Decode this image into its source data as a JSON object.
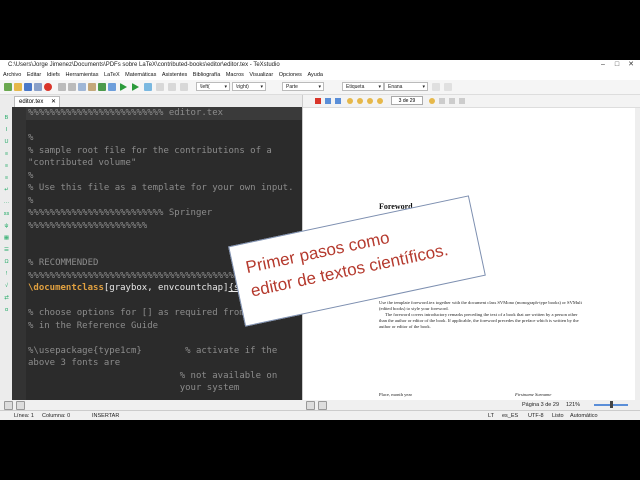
{
  "window": {
    "title": "C:\\Users\\Jorge Jimenez\\Documents\\PDFs sobre LaTeX\\contributed-books\\editor\\editor.tex - TeXstudio",
    "controls": [
      "–",
      "□",
      "✕"
    ]
  },
  "menu": [
    "Archivo",
    "Editar",
    "Idiefs",
    "Herramientas",
    "LaTeX",
    "Matemáticas",
    "Asistentes",
    "Bibliografía",
    "Macros",
    "Visualizar",
    "Opciones",
    "Ayuda"
  ],
  "toolbar": {
    "left_delim": "\\left(",
    "right_delim": "\\right)",
    "part": "Parte",
    "label": "Etiqueta",
    "font": "Enana"
  },
  "editor": {
    "tab_label": "editor.tex",
    "tab_close": "✕",
    "lines": [
      "%%%%%%%%%%%%%%%%%%%%%%%%% editor.tex",
      "%",
      "% sample root file for the contributions of a",
      "\"contributed volume\"",
      "%",
      "% Use this file as a template for your own input.",
      "%",
      "%%%%%%%%%%%%%%%%%%%%%%%%% Springer",
      "%%%%%%%%%%%%%%%%%%%%%%",
      "",
      "",
      "% RECOMMENDED",
      "%%%%%%%%%%%%%%%%%%%%%%%%%%%%%%%%%%%%%%%%%%%%",
      "",
      "",
      "% choose options for [] as required from the list",
      "% in the Reference Guide",
      "",
      "%\\usepackage{type1cm}        % activate if the",
      "above 3 fonts are",
      "                            % not available on",
      "                            your system"
    ],
    "docclass": {
      "cmd": "\\documentclass",
      "options": "[graybox, envcountchap]",
      "arg": "{svmult}"
    }
  },
  "viewer": {
    "page_number": "3 de 29",
    "heading": "Foreword",
    "para1": "Use the template foreword.tex together with the document class SVMono (monograph-type books) or SVMult (edited books) to style your foreword.",
    "para2": "The foreword covers introductory remarks preceding the text of a book that are written by a person other than the author or editor of the book. If applicable, the foreword precedes the preface which is written by the author or editor of the book.",
    "place": "Place, month year",
    "firstname": "Firstname Surname",
    "page_status": "Página 3 de 29",
    "zoom": "121%"
  },
  "overlay": {
    "line1": "Primer pasos como",
    "line2": "editor de textos científicos."
  },
  "status": {
    "line": "Línea: 1",
    "column": "Columna: 0",
    "mode": "INSERTAR",
    "lang": "es_ES",
    "encoding": "UTF-8",
    "ready": "Listo",
    "auto": "Automático"
  }
}
